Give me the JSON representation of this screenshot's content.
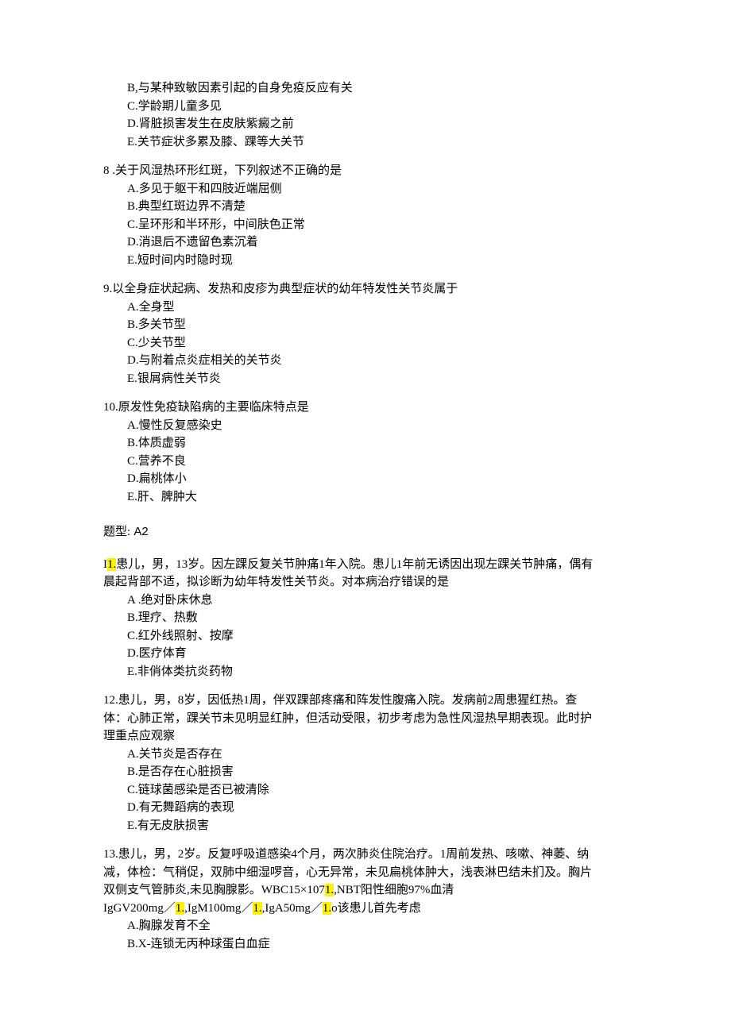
{
  "q7_partial": {
    "options": [
      "B,与某种致敏因素引起的自身免疫反应有关",
      "C.学龄期儿童多见",
      "D.肾脏损害发生在皮肤紫癜之前",
      "E.关节症状多累及膝、踝等大关节"
    ]
  },
  "q8": {
    "number": "8",
    "stem": ".关于风湿热环形红斑，下列叙述不正确的是",
    "options": [
      "A.多见于躯干和四肢近端屈侧",
      "B.典型红斑边界不清楚",
      "C.呈环形和半环形，中间肤色正常",
      "D.消退后不遗留色素沉着",
      "E.短时间内时隐时现"
    ]
  },
  "q9": {
    "number": "9.",
    "stem": "以全身症状起病、发热和皮疹为典型症状的幼年特发性关节炎属于",
    "options": [
      "A.全身型",
      "B.多关节型",
      "C.少关节型",
      "D.与附着点炎症相关的关节炎",
      "E.银屑病性关节炎"
    ]
  },
  "q10": {
    "number": "10.",
    "stem": "原发性免疫缺陷病的主要临床特点是",
    "options": [
      "A.慢性反复感染史",
      "B.体质虚弱",
      "C.营养不良",
      "D.扁桃体小",
      "E.肝、脾肿大"
    ]
  },
  "section": {
    "label": "题型:",
    "code": "A2"
  },
  "q11": {
    "prefix": "I",
    "hl_num": "1.",
    "stem_line1": "患儿，男，13岁。因左踝反复关节肿痛1年入院。患儿1年前无诱因出现左踝关节肿痛，偶有",
    "stem_line2": "晨起背部不适，拟诊断为幼年特发性关节炎。对本病治疗错误的是",
    "options": [
      "A .绝对卧床休息",
      "B.理疗、热敷",
      "C.红外线照射、按摩",
      "D.医疗体育",
      "E.非俏体类抗炎药物"
    ]
  },
  "q12": {
    "number": "12.",
    "stem_line1": "患儿，男，8岁，因低热1周，伴双踝部疼痛和阵发性腹痛入院。发病前2周患猩红热。查",
    "stem_line2": "体：心肺正常，踝关节未见明显红肿，但活动受限，初步考虑为急性风湿热早期表现。此时护",
    "stem_line3": "理重点应观察",
    "options": [
      "A.关节炎是否存在",
      "B.是否存在心脏损害",
      "C.链球菌感染是否已被清除",
      "D.有无舞蹈病的表现",
      "E.有无皮肤损害"
    ]
  },
  "q13": {
    "number": "13.",
    "stem_line1": "患儿，男，2岁。反复呼吸道感染4个月，两次肺炎住院治疗。1周前发热、咳嗽、神萎、纳",
    "stem_line2": "减，体检：气稍促，双肺中细湿啰音，心无异常，未见扁桃体肿大，浅表淋巴结未扪及。胸片",
    "stem_line3_a": "双侧支气管肺炎,未见胸腺影。WBC15×107",
    "stem_line3_b": ",NBT阳性细胞97%血清",
    "stem_line4_a": "IgGV200mg／",
    "stem_line4_b": ",IgM100mg／",
    "stem_line4_c": ",IgA50mg／",
    "stem_line4_d": "o该患儿首先考虑",
    "hl": "1.",
    "options": [
      "A.胸腺发育不全",
      "B.X-连锁无丙种球蛋白血症"
    ]
  }
}
